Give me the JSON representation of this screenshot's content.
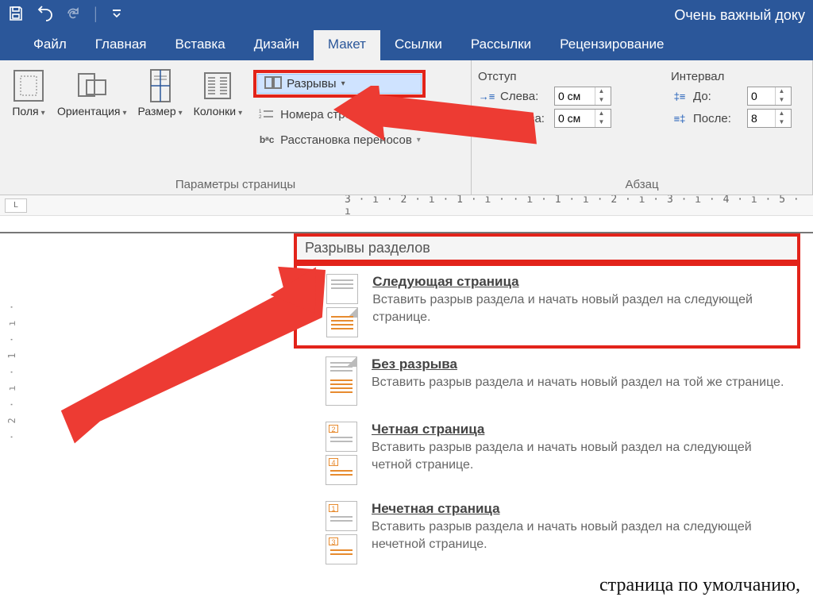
{
  "title": "Очень важный доку",
  "tabs": {
    "file": "Файл",
    "home": "Главная",
    "insert": "Вставка",
    "design": "Дизайн",
    "layout": "Макет",
    "references": "Ссылки",
    "mailings": "Рассылки",
    "review": "Рецензирование"
  },
  "pageSetup": {
    "margins": "Поля",
    "orientation": "Ориентация",
    "size": "Размер",
    "columns": "Колонки",
    "breaks": "Разрывы",
    "lineNumbers": "Номера строк",
    "hyphenation": "Расстановка переносов",
    "groupLabel": "Параметры страницы"
  },
  "indent": {
    "title": "Отступ",
    "leftLabel": "Слева:",
    "rightLabel": "Справа:",
    "leftValue": "0 см",
    "rightValue": "0 см"
  },
  "spacing": {
    "title": "Интервал",
    "beforeLabel": "До:",
    "afterLabel": "После:",
    "beforeValue": "0",
    "afterValue": "8"
  },
  "paragraphLabel": "Абзац",
  "rulerNumbers": "3 · ı · 2 · ı · 1 · ı ·   · ı · 1 · ı · 2 · ı · 3 · ı · 4 · ı · 5 · ı",
  "vertRuler": "· 2 · ı · 1 · ı ·",
  "dropdown": {
    "header": "Разрывы разделов",
    "items": [
      {
        "title": "Следующая страница",
        "desc": "Вставить разрыв раздела и начать новый раздел на следующей странице."
      },
      {
        "title": "Без разрыва",
        "desc": "Вставить разрыв раздела и начать новый раздел на той же странице."
      },
      {
        "title": "Четная страница",
        "desc": "Вставить разрыв раздела и начать новый раздел на следующей четной странице."
      },
      {
        "title": "Нечетная страница",
        "desc": "Вставить разрыв раздела и начать новый раздел на следующей нечетной странице."
      }
    ]
  },
  "pageText": "страница по умолчанию,",
  "iconBadges": {
    "even": "2",
    "evenB": "4",
    "odd": "1",
    "oddB": "3"
  }
}
